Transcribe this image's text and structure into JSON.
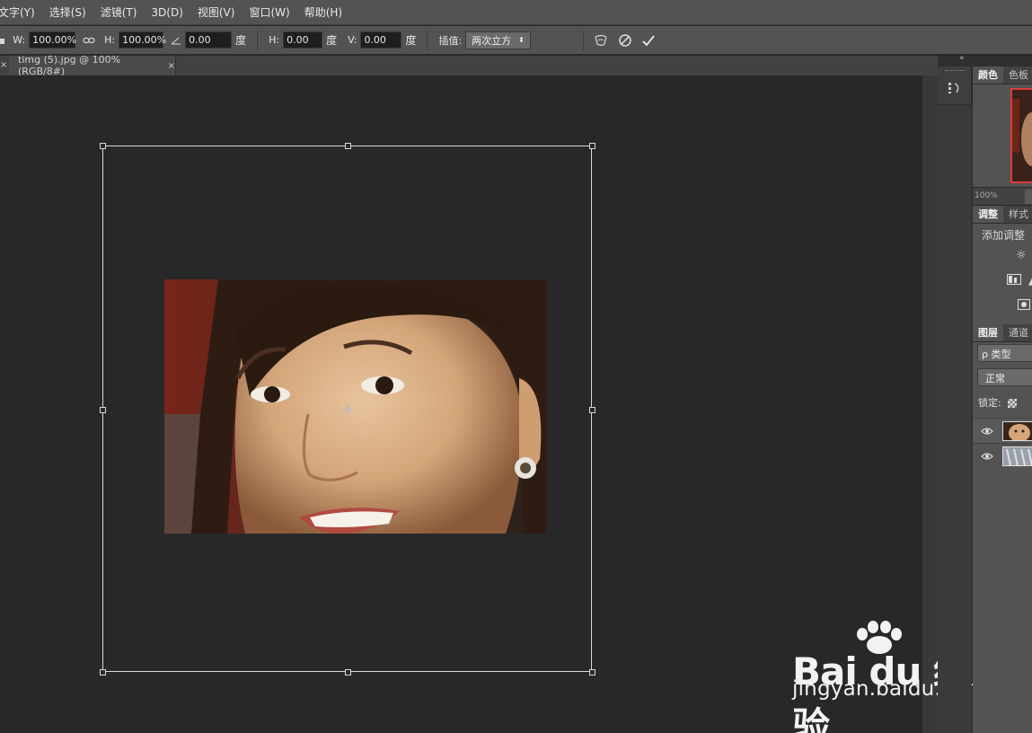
{
  "menu": [
    "文字(Y)",
    "选择(S)",
    "滤镜(T)",
    "3D(D)",
    "视图(V)",
    "窗口(W)",
    "帮助(H)"
  ],
  "options": {
    "w_label": "W:",
    "w_value": "100.00%",
    "h_label": "H:",
    "h_value": "100.00%",
    "angle_value": "0.00",
    "angle_unit": "度",
    "skew_h_label": "H:",
    "skew_h_value": "0.00",
    "skew_h_unit": "度",
    "skew_v_label": "V:",
    "skew_v_value": "0.00",
    "skew_v_unit": "度",
    "interp_label": "插值:",
    "interp_value": "两次立方"
  },
  "tab": {
    "title": "timg (5).jpg @ 100%(RGB/8#)",
    "close": "×",
    "left_close": "×"
  },
  "panels": {
    "color_tabs": [
      "颜色",
      "色板"
    ],
    "zoom": "100%",
    "adjust_tabs": [
      "调整",
      "样式"
    ],
    "adjust_title": "添加调整",
    "layers_tabs": [
      "图层",
      "通道"
    ],
    "search_label": "ρ 类型",
    "blend_mode": "正常",
    "lock_label": "锁定:"
  },
  "watermark": {
    "main": "Bai du 经验",
    "sub": "jingyan.baidu.com"
  },
  "colors": {
    "accent_nav": "#d93c3c",
    "menubar": "#535353",
    "canvas": "#282828"
  }
}
